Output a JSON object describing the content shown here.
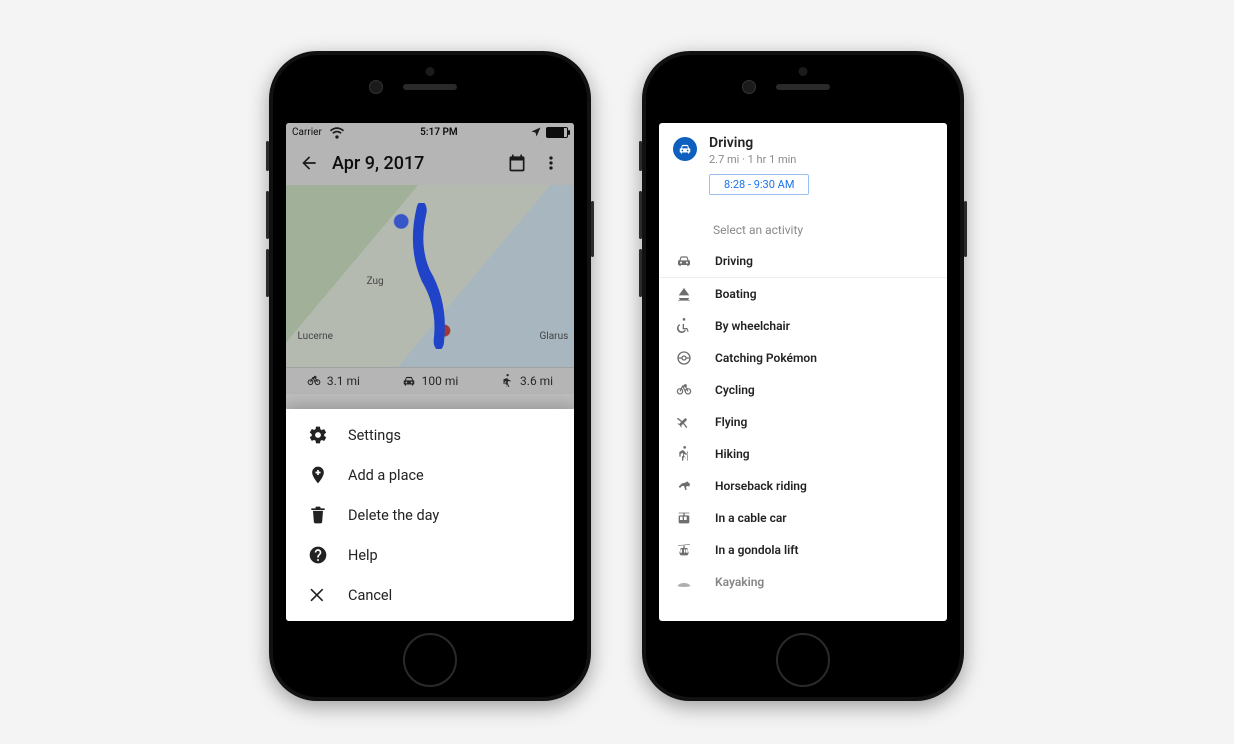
{
  "statusbar": {
    "carrier": "Carrier",
    "time": "5:17 PM"
  },
  "header": {
    "title": "Apr 9, 2017"
  },
  "map": {
    "labels": {
      "zug": "Zug",
      "lucerne": "Lucerne",
      "glarus": "Glarus"
    }
  },
  "stats": {
    "bike": "3.1 mi",
    "car": "100 mi",
    "walk": "3.6 mi"
  },
  "sheet": {
    "items": [
      {
        "icon": "gear-icon",
        "label": "Settings"
      },
      {
        "icon": "pin-plus-icon",
        "label": "Add a place"
      },
      {
        "icon": "trash-icon",
        "label": "Delete the day"
      },
      {
        "icon": "help-icon",
        "label": "Help"
      },
      {
        "icon": "close-icon",
        "label": "Cancel"
      }
    ]
  },
  "right": {
    "title": "Driving",
    "subtitle": "2.7 mi · 1 hr 1 min",
    "time_range": "8:28 - 9:30 AM",
    "section_label": "Select an activity",
    "activities": [
      {
        "icon": "car-icon",
        "label": "Driving"
      },
      {
        "icon": "boat-icon",
        "label": "Boating"
      },
      {
        "icon": "wheelchair-icon",
        "label": "By wheelchair"
      },
      {
        "icon": "pokeball-icon",
        "label": "Catching Pokémon"
      },
      {
        "icon": "bike-icon",
        "label": "Cycling"
      },
      {
        "icon": "plane-icon",
        "label": "Flying"
      },
      {
        "icon": "hiking-icon",
        "label": "Hiking"
      },
      {
        "icon": "horse-icon",
        "label": "Horseback riding"
      },
      {
        "icon": "cablecar-icon",
        "label": "In a cable car"
      },
      {
        "icon": "gondola-icon",
        "label": "In a gondola lift"
      },
      {
        "icon": "kayak-icon",
        "label": "Kayaking"
      }
    ]
  }
}
